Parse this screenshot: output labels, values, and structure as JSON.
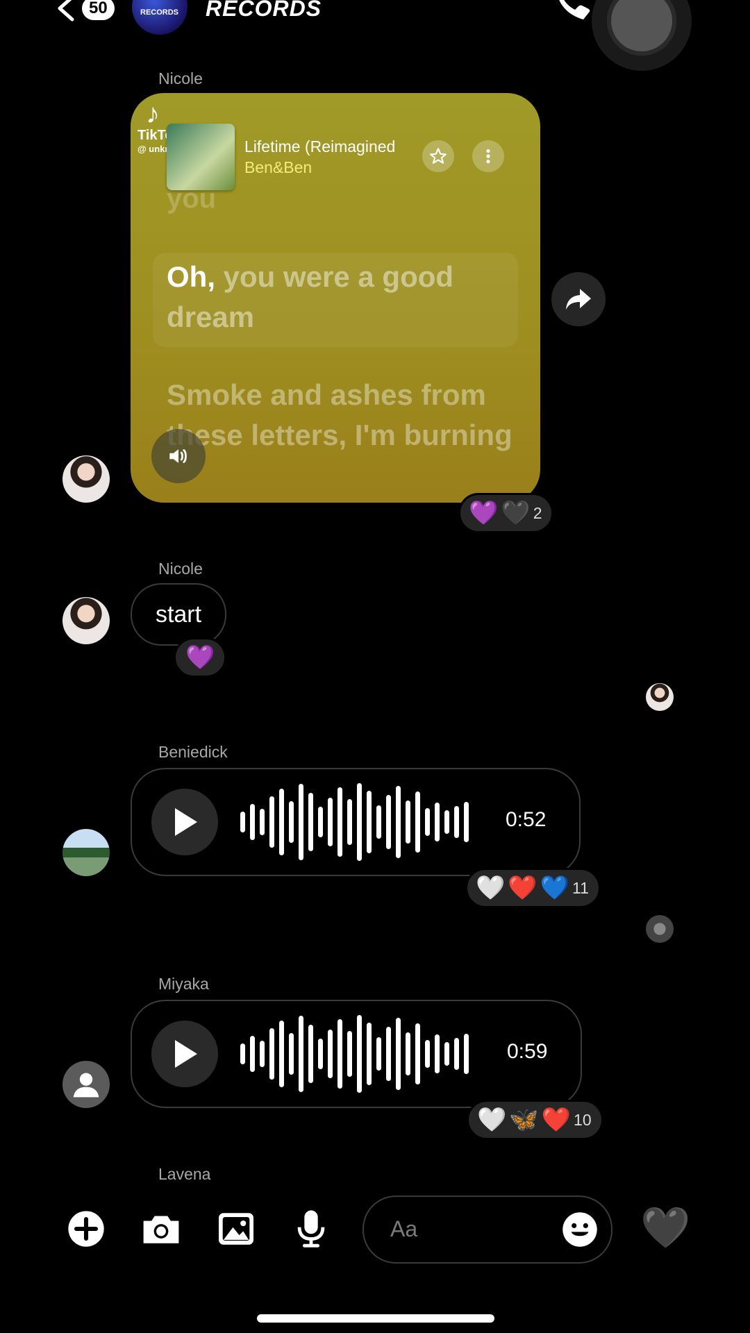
{
  "header": {
    "unread_count": "50",
    "group_avatar_text": "RECORDS",
    "group_name": "RECORDS"
  },
  "messages": {
    "m1": {
      "sender": "Nicole",
      "tiktok": {
        "brand": "TikTok",
        "handle": "@ unknxwn_xxxxx",
        "song_title": "Lifetime (Reimagined",
        "artist": "Ben&Ben",
        "lyric_prev": "you",
        "lyric_highlight": "Oh,",
        "lyric_rest": " you were a good dream",
        "lyric_next": "Smoke and ashes from these letters, I'm burning"
      },
      "reactions": {
        "emojis": [
          "💜",
          "🖤"
        ],
        "count": "2"
      }
    },
    "m2": {
      "sender": "Nicole",
      "text": "start",
      "reactions": {
        "emojis": [
          "💜"
        ]
      }
    },
    "m3": {
      "sender": "Beniedick",
      "duration": "0:52",
      "reactions": {
        "emojis": [
          "🤍",
          "❤️",
          "💙"
        ],
        "count": "11"
      }
    },
    "m4": {
      "sender": "Miyaka",
      "duration": "0:59",
      "reactions": {
        "emojis": [
          "🤍",
          "🦋",
          "❤️"
        ],
        "count": "10"
      }
    },
    "m5": {
      "sender": "Lavena"
    }
  },
  "composer": {
    "placeholder": "Aa",
    "like_emoji": "🖤"
  },
  "colors": {
    "background": "#000000",
    "card_yellow": "#a09a28",
    "bubble_border": "#3a3a3a",
    "reaction_bg": "#262626"
  }
}
